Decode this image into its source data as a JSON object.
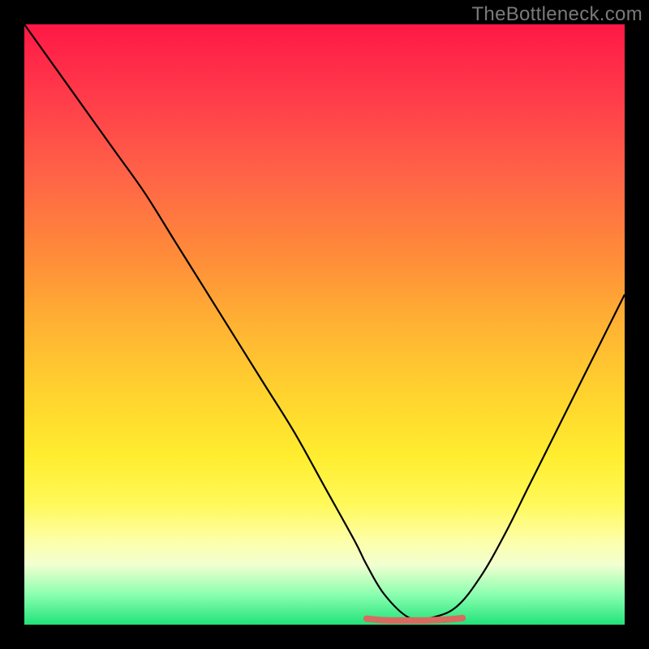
{
  "watermark": "TheBottleneck.com",
  "colors": {
    "frame": "#000000",
    "curve_stroke": "#000000",
    "optimal_marker": "#d86a60"
  },
  "chart_data": {
    "type": "line",
    "title": "",
    "xlabel": "",
    "ylabel": "",
    "xlim": [
      0,
      100
    ],
    "ylim": [
      0,
      100
    ],
    "series": [
      {
        "name": "bottleneck-curve-left",
        "x": [
          0,
          5,
          10,
          15,
          20,
          25,
          30,
          35,
          40,
          45,
          50,
          55,
          57,
          60,
          64,
          68
        ],
        "values": [
          100,
          93,
          86,
          79,
          72,
          64,
          56,
          48,
          40,
          32,
          23,
          14,
          10,
          5,
          1.2,
          0.7
        ]
      },
      {
        "name": "optimal-flat-segment",
        "x": [
          57,
          59,
          61,
          63,
          65,
          67,
          69,
          71,
          73
        ],
        "values": [
          1.0,
          0.8,
          0.7,
          0.7,
          0.7,
          0.7,
          0.8,
          0.9,
          1.1
        ]
      },
      {
        "name": "bottleneck-curve-right",
        "x": [
          64,
          68,
          72,
          76,
          80,
          84,
          88,
          92,
          96,
          100
        ],
        "values": [
          0.7,
          1.2,
          3,
          8,
          15,
          23,
          31,
          39,
          47,
          55
        ]
      }
    ],
    "annotations": [
      {
        "name": "optimal-range",
        "x_start": 57,
        "x_end": 73,
        "y": 1.0
      }
    ]
  }
}
